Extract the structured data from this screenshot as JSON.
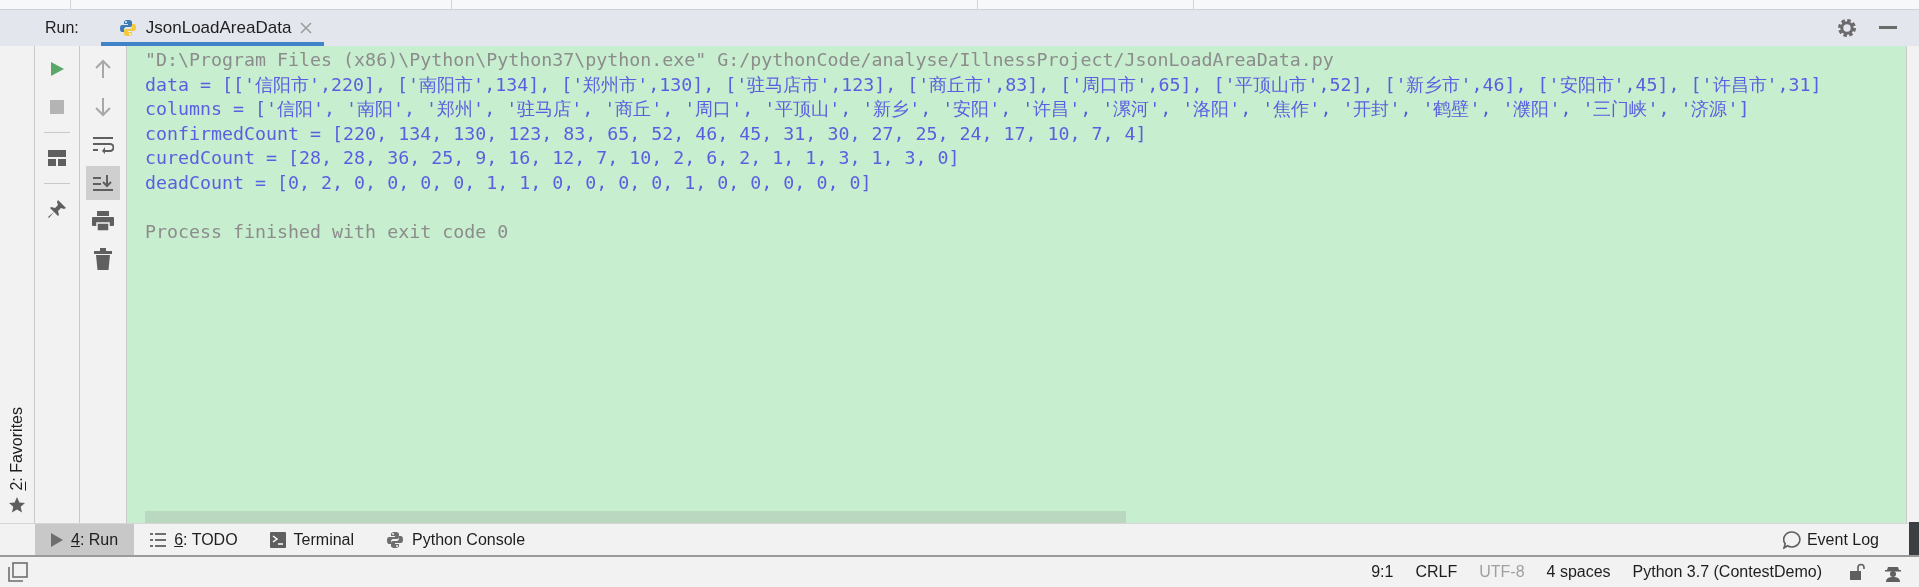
{
  "run_panel": {
    "label": "Run:",
    "tabs": [
      {
        "title": "JsonLoadAreaData",
        "selected": true
      }
    ]
  },
  "left_stripe": [
    {
      "mnemonic": "2",
      "label": ": Favorites"
    }
  ],
  "run_toolbar": [
    {
      "kind": "run",
      "disabled": false
    },
    {
      "kind": "stop",
      "disabled": true
    },
    {
      "kind": "layout",
      "disabled": false
    },
    {
      "kind": "pin",
      "disabled": false
    }
  ],
  "console_toolbar": [
    {
      "kind": "up",
      "on": false
    },
    {
      "kind": "down",
      "on": false
    },
    {
      "kind": "wrap",
      "on": false
    },
    {
      "kind": "scroll_end",
      "on": true
    },
    {
      "kind": "print",
      "on": false
    },
    {
      "kind": "trash",
      "on": false
    }
  ],
  "console": {
    "lines": [
      {
        "kind": "command",
        "text": "\"D:\\Program Files (x86)\\Python\\Python37\\python.exe\" G:/pythonCode/analyse/IllnessProject/JsonLoadAreaData.py"
      },
      {
        "kind": "output",
        "text": "data = [['信阳市',220], ['南阳市',134], ['郑州市',130], ['驻马店市',123], ['商丘市',83], ['周口市',65], ['平顶山市',52], ['新乡市',46], ['安阳市',45], ['许昌市',31]"
      },
      {
        "kind": "output",
        "text": "columns = ['信阳', '南阳', '郑州', '驻马店', '商丘', '周口', '平顶山', '新乡', '安阳', '许昌', '漯河', '洛阳', '焦作', '开封', '鹤壁', '濮阳', '三门峡', '济源']"
      },
      {
        "kind": "output",
        "text": "confirmedCount = [220, 134, 130, 123, 83, 65, 52, 46, 45, 31, 30, 27, 25, 24, 17, 10, 7, 4]"
      },
      {
        "kind": "output",
        "text": "curedCount = [28, 28, 36, 25, 9, 16, 12, 7, 10, 2, 6, 2, 1, 1, 3, 1, 3, 0]"
      },
      {
        "kind": "output",
        "text": "deadCount = [0, 2, 0, 0, 0, 0, 1, 1, 0, 0, 0, 0, 1, 0, 0, 0, 0, 0]"
      },
      {
        "kind": "status",
        "text": "Process finished with exit code 0"
      }
    ]
  },
  "tool_windows": [
    {
      "kind": "run",
      "mnemonic": "4",
      "label": ": Run",
      "selected": true
    },
    {
      "kind": "todo",
      "mnemonic": "6",
      "label": ": TODO",
      "selected": false
    },
    {
      "kind": "terminal",
      "label": "Terminal",
      "selected": false
    },
    {
      "kind": "python",
      "label": "Python Console",
      "selected": false
    }
  ],
  "event_log": {
    "label": "Event Log"
  },
  "status_bar": [
    {
      "text": "9:1",
      "muted": false
    },
    {
      "text": "CRLF",
      "muted": false
    },
    {
      "text": "UTF-8",
      "muted": true
    },
    {
      "text": "4 spaces",
      "muted": false
    },
    {
      "text": "Python 3.7 (ContestDemo)",
      "muted": false
    }
  ]
}
